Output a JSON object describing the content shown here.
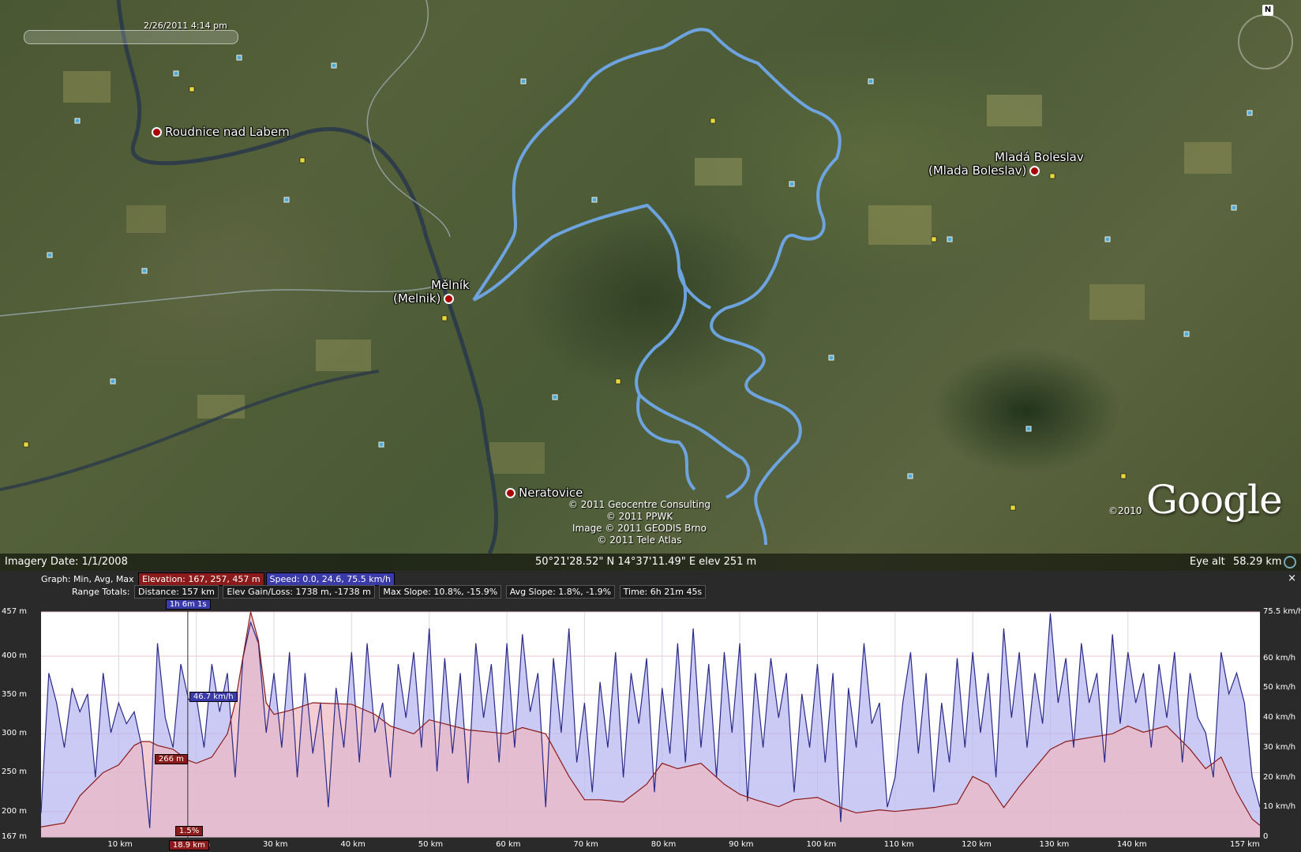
{
  "map": {
    "time_slider_label": "2/26/2011   4:14 pm",
    "places": [
      {
        "name": "Roudnice nad Labem"
      },
      {
        "name": "Mělník"
      },
      {
        "name": "(Melnik)"
      },
      {
        "name": "Mladá Boleslav"
      },
      {
        "name": "(Mlada Boleslav)"
      },
      {
        "name": "Neratovice"
      }
    ],
    "credits": [
      "© 2011 Geocentre Consulting",
      "© 2011 PPWK",
      "Image © 2011 GEODIS Brno",
      "© 2011 Tele Atlas"
    ],
    "logo": "Google",
    "logo_copyright": "©2010",
    "north_label": "N",
    "colors": {
      "track": "#6fa8e8",
      "border": "#b8c4d8",
      "river": "#2a3a4a"
    }
  },
  "status": {
    "imagery_date": "Imagery Date: 1/1/2008",
    "coords": "50°21'28.52\" N   14°37'11.49\" E  elev  251 m",
    "eye_alt_label": "Eye alt",
    "eye_alt_value": "58.29 km"
  },
  "profile": {
    "graph_label": "Graph: Min, Avg, Max",
    "elevation_chip": "Elevation: 167, 257, 457 m",
    "speed_chip": "Speed: 0.0, 24.6, 75.5 km/h",
    "range_label": "Range Totals:",
    "distance_chip": "Distance: 157 km",
    "gain_chip": "Elev Gain/Loss: 1738 m, -1738 m",
    "slope_chip": "Max Slope: 10.8%, -15.9%",
    "avg_slope_chip": "Avg Slope: 1.8%, -1.9%",
    "time_chip": "Time: 6h 21m 45s",
    "close": "×",
    "cursor": {
      "time_label": "1h 6m 1s",
      "speed_label": "46.7 km/h",
      "elev_label": "266 m",
      "slope_label": "1.5%",
      "dist_label": "18.9 km",
      "distance_km": 18.9
    },
    "colors": {
      "elevation": "#8b1a1a",
      "speed": "#2a2a8a",
      "elev_fill": "#f0b8c0",
      "speed_fill": "#b8b8f0"
    }
  },
  "chart_data": {
    "type": "area",
    "xlabel": "",
    "x_ticks": [
      "10 km",
      "20 km",
      "30 km",
      "40 km",
      "50 km",
      "60 km",
      "70 km",
      "80 km",
      "90 km",
      "100 km",
      "110 km",
      "120 km",
      "130 km",
      "140 km",
      "157 km"
    ],
    "y_left_ticks": [
      "457 m",
      "400 m",
      "350 m",
      "300 m",
      "250 m",
      "200 m",
      "167 m"
    ],
    "y_right_ticks": [
      "75.5 km/h",
      "60 km/h",
      "50 km/h",
      "40 km/h",
      "30 km/h",
      "20 km/h",
      "10 km/h",
      "0"
    ],
    "xlim": [
      0,
      157
    ],
    "y_left_lim": [
      167,
      457
    ],
    "y_right_lim": [
      0,
      75.5
    ],
    "series": [
      {
        "name": "Elevation",
        "x": [
          0,
          3,
          5,
          8,
          10,
          12,
          13,
          14,
          15,
          17,
          18.9,
          20,
          22,
          24,
          25,
          27,
          28,
          29,
          30,
          32,
          35,
          40,
          43,
          45,
          48,
          50,
          55,
          60,
          62,
          65,
          68,
          70,
          72,
          75,
          78,
          80,
          82,
          85,
          88,
          90,
          92,
          95,
          97,
          100,
          103,
          105,
          108,
          110,
          115,
          118,
          120,
          122,
          124,
          126,
          130,
          132,
          135,
          138,
          140,
          142,
          145,
          148,
          150,
          152,
          154,
          156,
          157
        ],
        "values": [
          180,
          185,
          220,
          250,
          260,
          285,
          290,
          290,
          285,
          280,
          266,
          262,
          270,
          300,
          340,
          457,
          420,
          340,
          325,
          330,
          340,
          338,
          325,
          310,
          300,
          318,
          305,
          300,
          308,
          300,
          245,
          215,
          215,
          212,
          235,
          262,
          255,
          262,
          235,
          222,
          215,
          206,
          215,
          218,
          205,
          198,
          202,
          200,
          205,
          210,
          245,
          235,
          205,
          232,
          280,
          290,
          295,
          300,
          310,
          302,
          310,
          280,
          255,
          270,
          225,
          190,
          182
        ]
      },
      {
        "name": "Speed",
        "x": [
          0,
          1,
          2,
          3,
          4,
          5,
          6,
          7,
          8,
          9,
          10,
          11,
          12,
          13,
          14,
          15,
          16,
          17,
          18,
          19,
          20,
          21,
          22,
          23,
          24,
          25,
          26,
          27,
          28,
          29,
          30,
          31,
          32,
          33,
          34,
          35,
          36,
          37,
          38,
          39,
          40,
          41,
          42,
          43,
          44,
          45,
          46,
          47,
          48,
          49,
          50,
          51,
          52,
          53,
          54,
          55,
          56,
          57,
          58,
          59,
          60,
          61,
          62,
          63,
          64,
          65,
          66,
          67,
          68,
          69,
          70,
          71,
          72,
          73,
          74,
          75,
          76,
          77,
          78,
          79,
          80,
          81,
          82,
          83,
          84,
          85,
          86,
          87,
          88,
          89,
          90,
          91,
          92,
          93,
          94,
          95,
          96,
          97,
          98,
          99,
          100,
          101,
          102,
          103,
          104,
          105,
          106,
          107,
          108,
          109,
          110,
          111,
          112,
          113,
          114,
          115,
          116,
          117,
          118,
          119,
          120,
          121,
          122,
          123,
          124,
          125,
          126,
          127,
          128,
          129,
          130,
          131,
          132,
          133,
          134,
          135,
          136,
          137,
          138,
          139,
          140,
          141,
          142,
          143,
          144,
          145,
          146,
          147,
          148,
          149,
          150,
          151,
          152,
          153,
          154,
          155,
          156,
          157
        ],
        "values": [
          8,
          55,
          45,
          30,
          50,
          42,
          48,
          20,
          55,
          35,
          45,
          38,
          42,
          30,
          3,
          65,
          40,
          30,
          58,
          46,
          47,
          30,
          58,
          42,
          55,
          20,
          60,
          72,
          65,
          35,
          55,
          30,
          62,
          20,
          55,
          28,
          45,
          10,
          50,
          30,
          62,
          25,
          65,
          35,
          45,
          20,
          58,
          40,
          62,
          30,
          70,
          22,
          60,
          28,
          55,
          18,
          65,
          40,
          58,
          25,
          65,
          30,
          68,
          42,
          55,
          10,
          60,
          35,
          70,
          25,
          45,
          15,
          52,
          30,
          62,
          20,
          55,
          38,
          60,
          15,
          50,
          28,
          65,
          25,
          70,
          30,
          58,
          20,
          62,
          35,
          65,
          12,
          55,
          30,
          60,
          40,
          55,
          15,
          48,
          30,
          58,
          25,
          55,
          5,
          50,
          30,
          65,
          38,
          45,
          10,
          20,
          45,
          62,
          28,
          55,
          15,
          45,
          25,
          60,
          30,
          62,
          35,
          55,
          20,
          70,
          40,
          62,
          30,
          55,
          38,
          75,
          45,
          60,
          30,
          65,
          45,
          55,
          25,
          68,
          38,
          62,
          45,
          55,
          30,
          58,
          40,
          62,
          25,
          55,
          40,
          35,
          20,
          62,
          48,
          55,
          45,
          20,
          10
        ]
      }
    ]
  }
}
